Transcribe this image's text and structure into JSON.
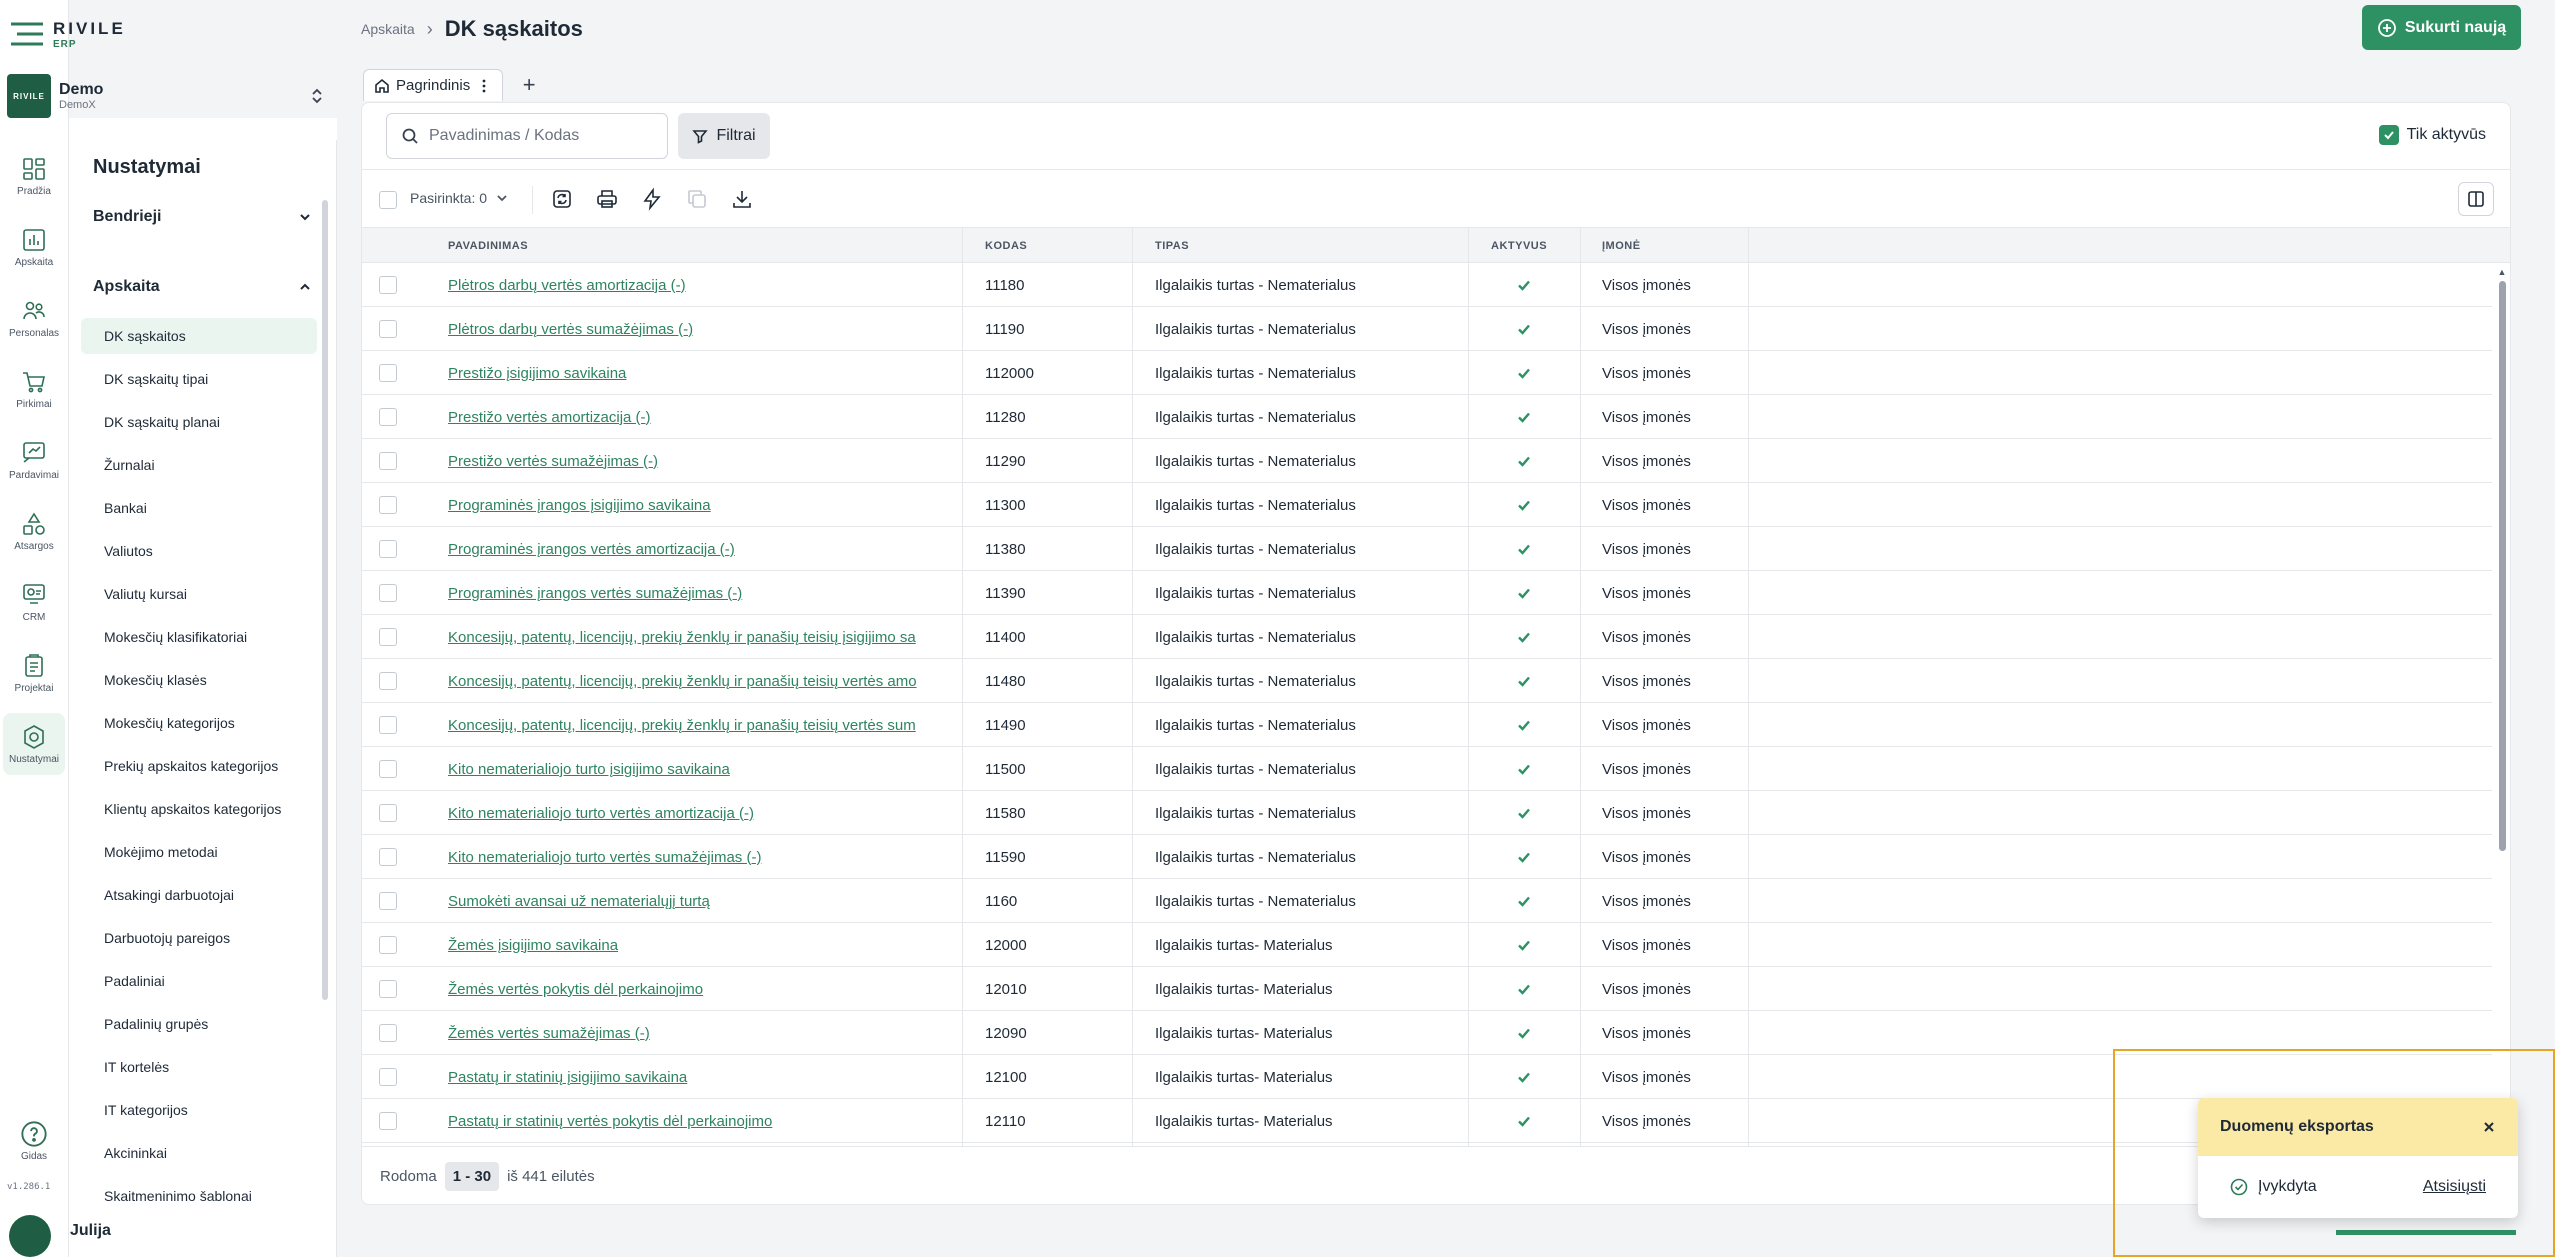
{
  "brand": {
    "name": "RIVILE",
    "sub": "ERP"
  },
  "company": {
    "name": "Demo",
    "sub": "DemoX",
    "logo_text": "RIVILE"
  },
  "rail": {
    "items": [
      {
        "label": "Pradžia",
        "icon": "dashboard-icon"
      },
      {
        "label": "Apskaita",
        "icon": "chart-icon"
      },
      {
        "label": "Personalas",
        "icon": "people-icon"
      },
      {
        "label": "Pirkimai",
        "icon": "cart-icon"
      },
      {
        "label": "Pardavimai",
        "icon": "sales-icon"
      },
      {
        "label": "Atsargos",
        "icon": "shapes-icon"
      },
      {
        "label": "CRM",
        "icon": "crm-icon"
      },
      {
        "label": "Projektai",
        "icon": "clipboard-icon"
      },
      {
        "label": "Nustatymai",
        "icon": "settings-icon"
      }
    ],
    "help_label": "Gidas",
    "version": "v1.286.1"
  },
  "settings": {
    "title": "Nustatymai",
    "sections": [
      {
        "label": "Bendrieji",
        "expanded": false
      },
      {
        "label": "Apskaita",
        "expanded": true
      }
    ],
    "items": [
      "DK sąskaitos",
      "DK sąskaitų tipai",
      "DK sąskaitų planai",
      "Žurnalai",
      "Bankai",
      "Valiutos",
      "Valiutų kursai",
      "Mokesčių klasifikatoriai",
      "Mokesčių klasės",
      "Mokesčių kategorijos",
      "Prekių apskaitos kategorijos",
      "Klientų apskaitos kategorijos",
      "Mokėjimo metodai",
      "Atsakingi darbuotojai",
      "Darbuotojų pareigos",
      "Padaliniai",
      "Padalinių grupės",
      "IT kortelės",
      "IT kategorijos",
      "Akcininkai",
      "Skaitmeninimo šablonai"
    ],
    "active_item": "DK sąskaitos"
  },
  "user": {
    "name": "Julija"
  },
  "breadcrumb": {
    "parent": "Apskaita",
    "title": "DK sąskaitos"
  },
  "create_button": "Sukurti naują",
  "tabs": {
    "current": "Pagrindinis"
  },
  "search": {
    "placeholder": "Pavadinimas / Kodas",
    "value": ""
  },
  "filter_button": "Filtrai",
  "only_active": {
    "label": "Tik aktyvūs",
    "checked": true
  },
  "toolbar": {
    "selected_label": "Pasirinkta: 0"
  },
  "table": {
    "columns": [
      "PAVADINIMAS",
      "KODAS",
      "TIPAS",
      "AKTYVUS",
      "ĮMONĖ"
    ],
    "rows": [
      {
        "name": "Plėtros darbų vertės amortizacija (-)",
        "code": "11180",
        "type": "Ilgalaikis turtas - Nematerialus",
        "active": true,
        "company": "Visos įmonės"
      },
      {
        "name": "Plėtros darbų vertės sumažėjimas (-)",
        "code": "11190",
        "type": "Ilgalaikis turtas - Nematerialus",
        "active": true,
        "company": "Visos įmonės"
      },
      {
        "name": "Prestižo įsigijimo savikaina",
        "code": "112000",
        "type": "Ilgalaikis turtas - Nematerialus",
        "active": true,
        "company": "Visos įmonės"
      },
      {
        "name": "Prestižo vertės amortizacija (-)",
        "code": "11280",
        "type": "Ilgalaikis turtas - Nematerialus",
        "active": true,
        "company": "Visos įmonės"
      },
      {
        "name": "Prestižo vertės sumažėjimas (-)",
        "code": "11290",
        "type": "Ilgalaikis turtas - Nematerialus",
        "active": true,
        "company": "Visos įmonės"
      },
      {
        "name": "Programinės įrangos įsigijimo savikaina",
        "code": "11300",
        "type": "Ilgalaikis turtas - Nematerialus",
        "active": true,
        "company": "Visos įmonės"
      },
      {
        "name": "Programinės įrangos vertės amortizacija (-)",
        "code": "11380",
        "type": "Ilgalaikis turtas - Nematerialus",
        "active": true,
        "company": "Visos įmonės"
      },
      {
        "name": "Programinės įrangos vertės sumažėjimas (-)",
        "code": "11390",
        "type": "Ilgalaikis turtas - Nematerialus",
        "active": true,
        "company": "Visos įmonės"
      },
      {
        "name": "Koncesijų, patentų, licencijų, prekių ženklų ir panašių teisių įsigijimo sa",
        "code": "11400",
        "type": "Ilgalaikis turtas - Nematerialus",
        "active": true,
        "company": "Visos įmonės"
      },
      {
        "name": "Koncesijų, patentų, licencijų, prekių ženklų ir panašių teisių vertės amo",
        "code": "11480",
        "type": "Ilgalaikis turtas - Nematerialus",
        "active": true,
        "company": "Visos įmonės"
      },
      {
        "name": "Koncesijų, patentų, licencijų, prekių ženklų ir panašių teisių vertės sum",
        "code": "11490",
        "type": "Ilgalaikis turtas - Nematerialus",
        "active": true,
        "company": "Visos įmonės"
      },
      {
        "name": "Kito nematerialiojo turto įsigijimo savikaina",
        "code": "11500",
        "type": "Ilgalaikis turtas - Nematerialus",
        "active": true,
        "company": "Visos įmonės"
      },
      {
        "name": "Kito nematerialiojo turto vertės amortizacija (-)",
        "code": "11580",
        "type": "Ilgalaikis turtas - Nematerialus",
        "active": true,
        "company": "Visos įmonės"
      },
      {
        "name": "Kito nematerialiojo turto vertės sumažėjimas (-)",
        "code": "11590",
        "type": "Ilgalaikis turtas - Nematerialus",
        "active": true,
        "company": "Visos įmonės"
      },
      {
        "name": "Sumokėti avansai už nematerialųjį turtą",
        "code": "1160",
        "type": "Ilgalaikis turtas - Nematerialus",
        "active": true,
        "company": "Visos įmonės"
      },
      {
        "name": "Žemės įsigijimo savikaina",
        "code": "12000",
        "type": "Ilgalaikis turtas- Materialus",
        "active": true,
        "company": "Visos įmonės"
      },
      {
        "name": "Žemės vertės pokytis dėl perkainojimo",
        "code": "12010",
        "type": "Ilgalaikis turtas- Materialus",
        "active": true,
        "company": "Visos įmonės"
      },
      {
        "name": "Žemės vertės sumažėjimas (-)",
        "code": "12090",
        "type": "Ilgalaikis turtas- Materialus",
        "active": true,
        "company": "Visos įmonės"
      },
      {
        "name": "Pastatų ir statinių įsigijimo savikaina",
        "code": "12100",
        "type": "Ilgalaikis turtas- Materialus",
        "active": true,
        "company": "Visos įmonės"
      },
      {
        "name": "Pastatų ir statinių vertės pokytis dėl perkainojimo",
        "code": "12110",
        "type": "Ilgalaikis turtas- Materialus",
        "active": true,
        "company": "Visos įmonės"
      }
    ]
  },
  "pagination": {
    "prefix": "Rodoma",
    "range": "1 - 30",
    "suffix": "iš 441 eilutės"
  },
  "toast": {
    "title": "Duomenų eksportas",
    "status": "Įvykdyta",
    "action": "Atsisiųsti"
  },
  "colors": {
    "accent": "#2e9164",
    "link": "#2e8460",
    "toast_header": "#fbe9a6",
    "highlight_frame": "#e6a623"
  }
}
